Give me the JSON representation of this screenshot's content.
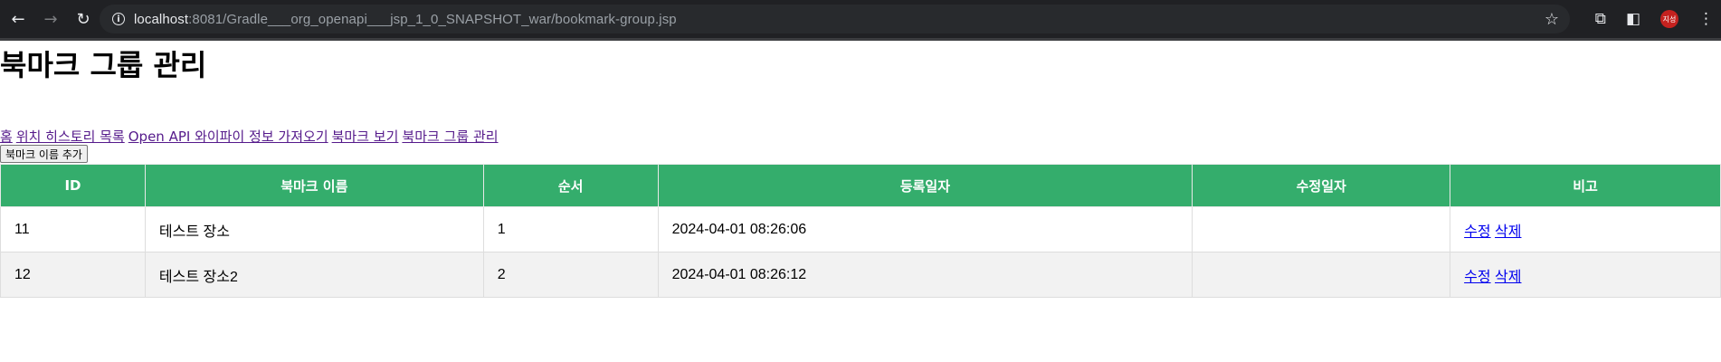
{
  "browser": {
    "url_host": "localhost",
    "url_path": ":8081/Gradle___org_openapi___jsp_1_0_SNAPSHOT_war/bookmark-group.jsp",
    "avatar_text": "지성"
  },
  "page": {
    "title": "북마크 그룹 관리",
    "nav": [
      "홈",
      "위치 히스토리 목록",
      "Open API 와이파이 정보 가져오기",
      "북마크 보기",
      "북마크 그룹 관리"
    ],
    "add_button": "북마크 이름 추가"
  },
  "table": {
    "headers": [
      "ID",
      "북마크 이름",
      "순서",
      "등록일자",
      "수정일자",
      "비고"
    ],
    "rows": [
      {
        "id": "11",
        "name": "테스트 장소",
        "order": "1",
        "created": "2024-04-01 08:26:06",
        "modified": "",
        "edit": "수정",
        "delete": "삭제"
      },
      {
        "id": "12",
        "name": "테스트 장소2",
        "order": "2",
        "created": "2024-04-01 08:26:12",
        "modified": "",
        "edit": "수정",
        "delete": "삭제"
      }
    ]
  },
  "colors": {
    "header_bg": "#34ad6c",
    "alt_row_bg": "#f2f2f2",
    "visited_link": "#551a8b",
    "link": "#0000ee"
  }
}
